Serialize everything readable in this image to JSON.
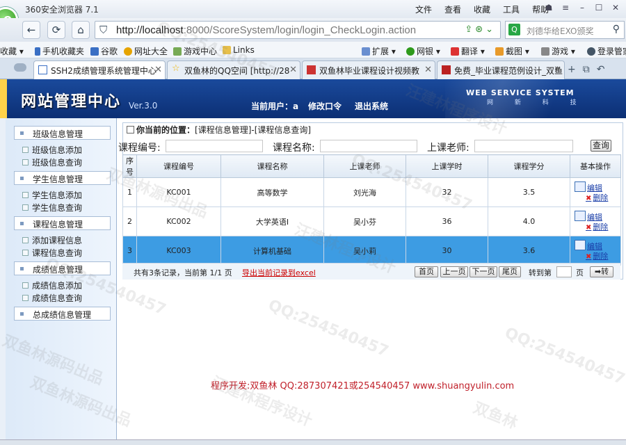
{
  "browser": {
    "title": "360安全浏览器 7.1",
    "menus": [
      "文件",
      "查看",
      "收藏",
      "工具",
      "帮助"
    ],
    "address_host": "http://localhost",
    "address_rest": ":8000/ScoreSystem/login/login_CheckLogin.action",
    "search_text": "刘德华给EXO颁奖"
  },
  "favorites": [
    {
      "label": "收藏",
      "color": "#666666"
    },
    {
      "label": "手机收藏夹",
      "color": "#3a6fc4"
    },
    {
      "label": "谷歌",
      "color": "#3a6fc4"
    },
    {
      "label": "网址大全",
      "color": "#e6a400"
    },
    {
      "label": "游戏中心",
      "color": "#7a5"
    },
    {
      "label": "Links",
      "color": "#e8c04a"
    },
    {
      "label": "扩展",
      "color": "#6a8fd0"
    },
    {
      "label": "网银",
      "color": "#2e9a1c"
    },
    {
      "label": "翻译",
      "color": "#d33"
    },
    {
      "label": "截图",
      "color": "#e89a2a"
    },
    {
      "label": "游戏",
      "color": "#666"
    },
    {
      "label": "登录管家",
      "color": "#456"
    }
  ],
  "tabs": [
    {
      "label": "SSH2成绩管理系统管理中心",
      "active": true,
      "color": "#3a6fc4"
    },
    {
      "label": "双鱼林的QQ空间 [http://28",
      "active": false,
      "color": "#f0b400"
    },
    {
      "label": "双鱼林毕业课程设计视频教",
      "active": false,
      "color": "#c33"
    },
    {
      "label": "免费_毕业课程范例设计_双鱼",
      "active": false,
      "color": "#b22"
    }
  ],
  "header": {
    "brand": "网站管理中心",
    "version": "Ver.3.0",
    "current_user": "当前用户：a",
    "change_password": "修改口令",
    "logout": "退出系统",
    "ws_title": "WEB SERVICE SYSTEM",
    "ws_sub": "网 新 科 技"
  },
  "sidebar": {
    "groups": [
      {
        "title": "班级信息管理",
        "items": [
          "班级信息添加",
          "班级信息查询"
        ]
      },
      {
        "title": "学生信息管理",
        "items": [
          "学生信息添加",
          "学生信息查询"
        ]
      },
      {
        "title": "课程信息管理",
        "items": [
          "添加课程信息",
          "课程信息查询"
        ]
      },
      {
        "title": "成绩信息管理",
        "items": [
          "成绩信息添加",
          "成绩信息查询"
        ]
      },
      {
        "title": "总成绩信息管理",
        "items": []
      }
    ]
  },
  "main": {
    "location_label": "你当前的位置：",
    "location_path": "[课程信息管理]-[课程信息查询]",
    "query": {
      "course_no_label": "课程编号:",
      "course_name_label": "课程名称:",
      "teacher_label": "上课老师:",
      "course_no_value": "",
      "course_name_value": "",
      "teacher_value": "",
      "button": "查询"
    },
    "table": {
      "headers": [
        "序号",
        "课程编号",
        "课程名称",
        "上课老师",
        "上课学时",
        "课程学分",
        "基本操作"
      ],
      "rows": [
        {
          "no": "1",
          "code": "KC001",
          "name": "高等数学",
          "teacher": "刘光海",
          "hours": "32",
          "credit": "3.5",
          "selected": false
        },
        {
          "no": "2",
          "code": "KC002",
          "name": "大学英语I",
          "teacher": "吴小芬",
          "hours": "36",
          "credit": "4.0",
          "selected": false
        },
        {
          "no": "3",
          "code": "KC003",
          "name": "计算机基础",
          "teacher": "吴小莉",
          "hours": "30",
          "credit": "3.6",
          "selected": true
        }
      ],
      "edit_label": "编辑",
      "delete_label": "删除"
    },
    "pager": {
      "info": "共有3条记录，当前第 1/1 页",
      "export": "导出当前记录到excel",
      "first": "首页",
      "prev": "上一页",
      "next": "下一页",
      "last": "尾页",
      "goto_label": "转到第",
      "page_value": "",
      "page_unit": "页",
      "go": "➡转"
    }
  },
  "credit": "程序开发:双鱼林 QQ:287307421或254540457 www.shuangyulin.com",
  "watermarks": [
    "QQ:254540457",
    "汪建林程序设计",
    "双鱼林源码出品",
    "QQ:254540457",
    "汪建林程序设计",
    "QQ:254540457",
    "双鱼林源码出品",
    "QQ:254540457",
    "汪建林程序设计",
    "双鱼林源码出品",
    "QQ:254540457",
    "双鱼林"
  ]
}
